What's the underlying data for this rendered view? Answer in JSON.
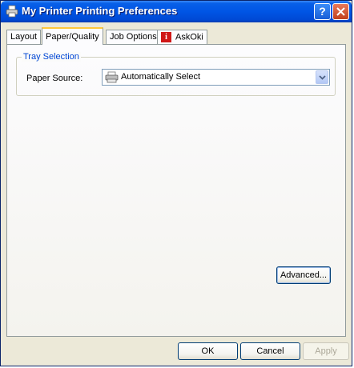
{
  "window": {
    "title": "My Printer Printing Preferences",
    "help_label": "?",
    "accent": "#0055e5"
  },
  "tabs": [
    {
      "label": "Layout",
      "selected": false
    },
    {
      "label": "Paper/Quality",
      "selected": true
    },
    {
      "label": "Job Options",
      "selected": false
    },
    {
      "label": "AskOki",
      "selected": false,
      "icon": "info-icon"
    }
  ],
  "tray": {
    "group_title": "Tray Selection",
    "paper_source_label": "Paper Source:",
    "paper_source_value": "Automatically Select",
    "icon": "printer-icon"
  },
  "buttons": {
    "advanced": "Advanced...",
    "ok": "OK",
    "cancel": "Cancel",
    "apply": "Apply"
  }
}
